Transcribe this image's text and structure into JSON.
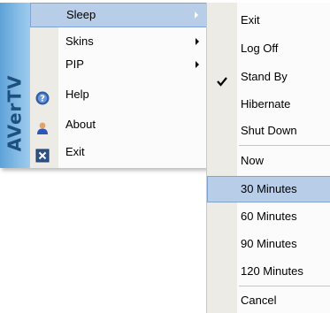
{
  "brand": {
    "text": "AVerTV",
    "color": "#5ea2d7"
  },
  "main_menu": {
    "items": [
      {
        "label": "Sleep",
        "submenu": true,
        "selected": true
      },
      {
        "label": "Skins",
        "submenu": true
      },
      {
        "label": "PIP",
        "submenu": true
      },
      {
        "label": "Help",
        "icon": "help-icon"
      },
      {
        "label": "About",
        "icon": "user-icon"
      },
      {
        "label": "Exit",
        "icon": "close-box-icon"
      }
    ]
  },
  "sub_menu": {
    "items": [
      {
        "label": "Exit"
      },
      {
        "label": "Log Off"
      },
      {
        "label": "Stand By",
        "checked": true
      },
      {
        "label": "Hibernate"
      },
      {
        "label": "Shut Down"
      },
      {
        "label": "Now"
      },
      {
        "label": "30 Minutes",
        "selected": true
      },
      {
        "label": "60 Minutes"
      },
      {
        "label": "90 Minutes"
      },
      {
        "label": "120 Minutes"
      },
      {
        "label": "Cancel"
      }
    ]
  },
  "colors": {
    "highlight": "#b7cde8",
    "highlight_border": "#7fa4d2",
    "gutter": "#ecebe6"
  }
}
